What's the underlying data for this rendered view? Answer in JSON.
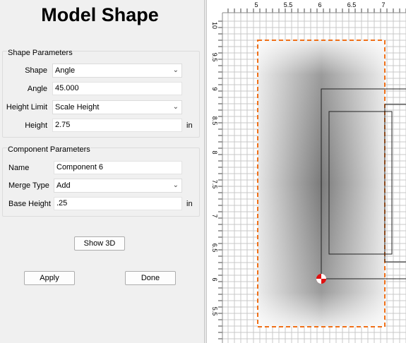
{
  "title": "Model Shape",
  "shape_params": {
    "group_title": "Shape Parameters",
    "shape_label": "Shape",
    "shape_value": "Angle",
    "angle_label": "Angle",
    "angle_value": "45.000",
    "height_limit_label": "Height Limit",
    "height_limit_value": "Scale Height",
    "height_label": "Height",
    "height_value": "2.75",
    "height_unit": "in"
  },
  "component_params": {
    "group_title": "Component Parameters",
    "name_label": "Name",
    "name_value": "Component 6",
    "merge_label": "Merge Type",
    "merge_value": "Add",
    "base_height_label": "Base Height",
    "base_height_value": ".25",
    "base_height_unit": "in"
  },
  "buttons": {
    "show3d": "Show 3D",
    "apply": "Apply",
    "done": "Done"
  },
  "ruler": {
    "x_ticks": [
      "5",
      "5.5",
      "6",
      "6.5",
      "7"
    ],
    "y_ticks": [
      "10",
      "9.5",
      "9",
      "8.5",
      "8",
      "7.5",
      "7",
      "6.5",
      "6",
      "5.5"
    ]
  },
  "colors": {
    "shape_outline": "#f07018",
    "origin_marker": "#e01010"
  }
}
